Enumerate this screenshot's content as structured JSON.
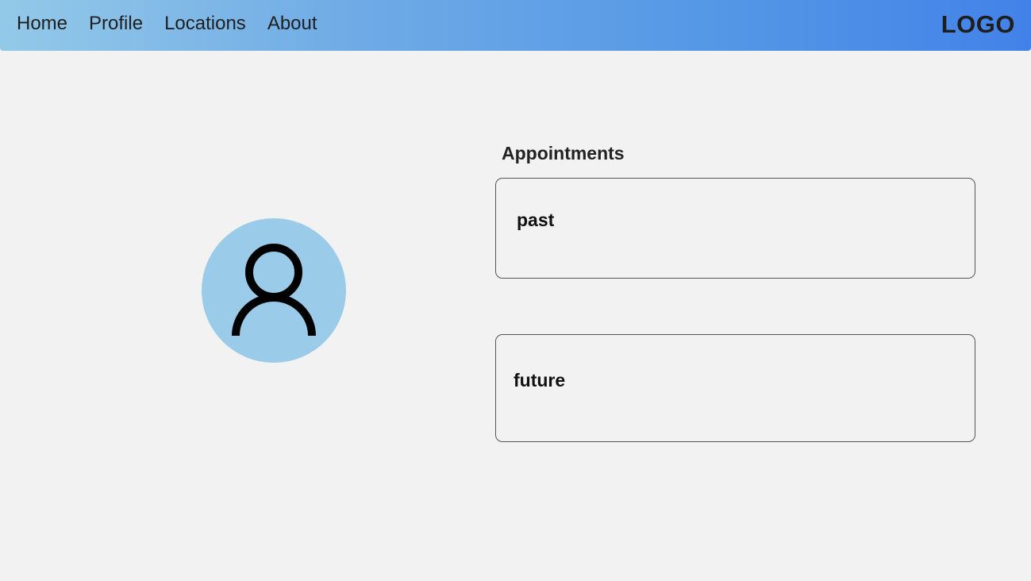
{
  "nav": {
    "links": [
      "Home",
      "Profile",
      "Locations",
      "About"
    ],
    "logo": "LOGO"
  },
  "profile": {
    "avatar_icon": "user-icon"
  },
  "appointments": {
    "heading": "Appointments",
    "past_label": "past",
    "future_label": "future"
  },
  "colors": {
    "nav_gradient_start": "#93c9e8",
    "nav_gradient_end": "#4282e8",
    "avatar_bg": "#9acbe8",
    "page_bg": "#f2f2f2"
  }
}
